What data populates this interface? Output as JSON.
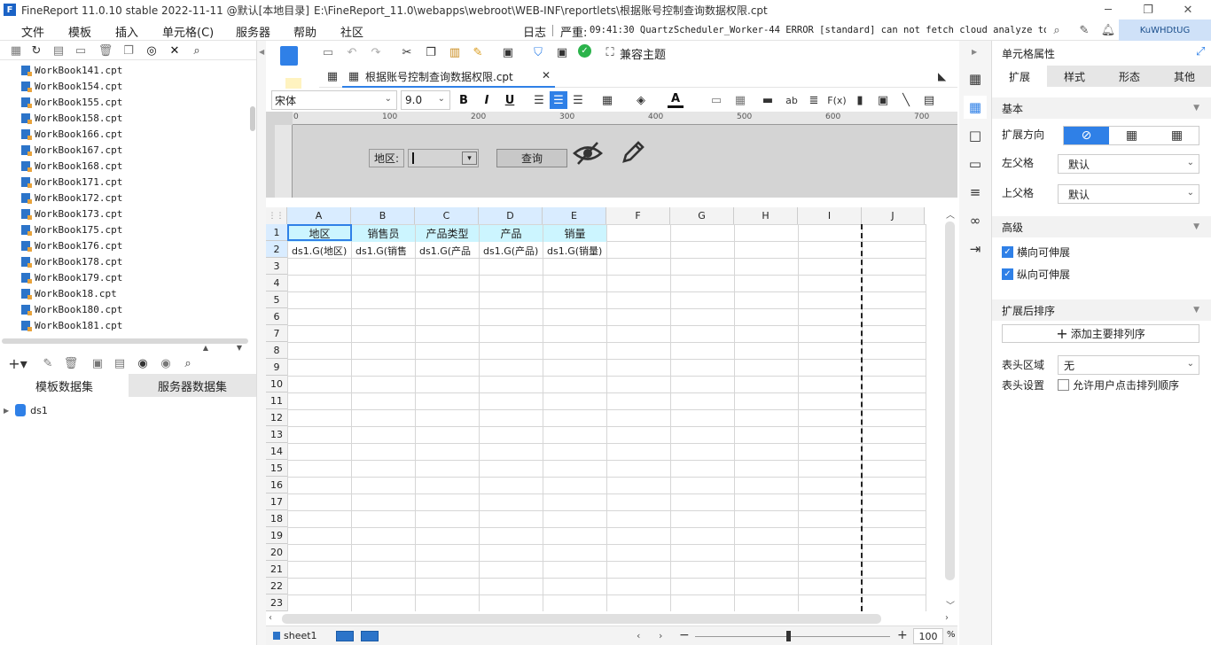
{
  "titlebar": {
    "app_title": "FineReport 11.0.10 stable 2022-11-11 @默认[本地目录]",
    "file_path": "E:\\FineReport_11.0\\webapps\\webroot\\WEB-INF\\reportlets\\根据账号控制查询数据权限.cpt"
  },
  "menu": {
    "items": [
      "文件",
      "模板",
      "插入",
      "单元格(C)",
      "服务器",
      "帮助",
      "社区"
    ],
    "log_label": "日志",
    "severity_label": "严重:",
    "log_message": "09:41:30 QuartzScheduler_Worker-44 ERROR [standard] can not fetch cloud analyze token.",
    "user_badge": "KuWHDtUG"
  },
  "left_panel": {
    "files": [
      "WorkBook141.cpt",
      "WorkBook154.cpt",
      "WorkBook155.cpt",
      "WorkBook158.cpt",
      "WorkBook166.cpt",
      "WorkBook167.cpt",
      "WorkBook168.cpt",
      "WorkBook171.cpt",
      "WorkBook172.cpt",
      "WorkBook173.cpt",
      "WorkBook175.cpt",
      "WorkBook176.cpt",
      "WorkBook178.cpt",
      "WorkBook179.cpt",
      "WorkBook18.cpt",
      "WorkBook180.cpt",
      "WorkBook181.cpt"
    ],
    "tab_template_dataset": "模板数据集",
    "tab_server_dataset": "服务器数据集",
    "dataset_name": "ds1"
  },
  "editor": {
    "compat_theme": "兼容主题",
    "tab_name": "根据账号控制查询数据权限.cpt",
    "font_name": "宋体",
    "font_size": "9.0",
    "ruler_marks": [
      "0",
      "100",
      "200",
      "300",
      "400",
      "500",
      "600",
      "700"
    ],
    "param_label": "地区:",
    "query_button": "查询"
  },
  "grid": {
    "columns": [
      "A",
      "B",
      "C",
      "D",
      "E",
      "F",
      "G",
      "H",
      "I",
      "J"
    ],
    "rows": [
      "1",
      "2",
      "3",
      "4",
      "5",
      "6",
      "7",
      "8",
      "9",
      "10",
      "11",
      "12",
      "13",
      "14",
      "15",
      "16",
      "17",
      "18",
      "19",
      "20",
      "21",
      "22",
      "23"
    ],
    "header_row": [
      "地区",
      "销售员",
      "产品类型",
      "产品",
      "销量"
    ],
    "data_row": [
      "ds1.G(地区)",
      "ds1.G(销售",
      "ds1.G(产品",
      "ds1.G(产品)",
      "ds1.G(销量)"
    ]
  },
  "bottom": {
    "sheet_name": "sheet1",
    "zoom": "100",
    "zoom_unit": "%"
  },
  "right_panel": {
    "title": "单元格属性",
    "tabs": [
      "扩展",
      "样式",
      "形态",
      "其他"
    ],
    "section_basic": "基本",
    "expand_direction": "扩展方向",
    "left_parent": "左父格",
    "left_parent_value": "默认",
    "top_parent": "上父格",
    "top_parent_value": "默认",
    "section_advanced": "高级",
    "horizontal_expand": "横向可伸展",
    "vertical_expand": "纵向可伸展",
    "section_sort": "扩展后排序",
    "add_sort": "添加主要排列序",
    "header_area": "表头区域",
    "header_area_value": "无",
    "header_settings": "表头设置",
    "allow_sort_click": "允许用户点击排列顺序"
  },
  "colors": {
    "accent": "#2f80e7",
    "header_cell": "#ccf5ff",
    "param_area": "#d4d4d4"
  }
}
